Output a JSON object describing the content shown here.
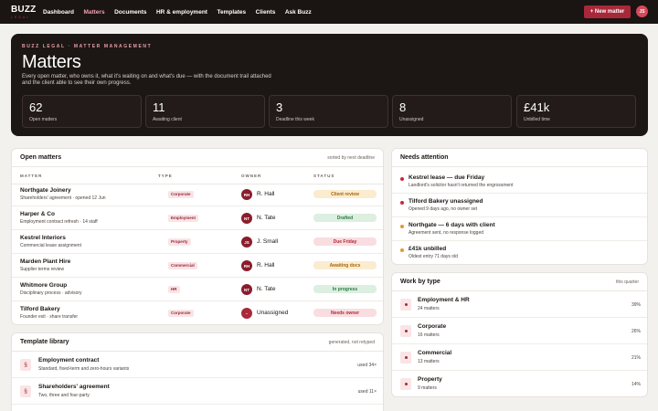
{
  "nav": {
    "logo": "BUZZ",
    "logo_sub": "LEGAL",
    "links": [
      "Dashboard",
      "Matters",
      "Documents",
      "HR & employment",
      "Templates",
      "Clients",
      "Ask Buzz"
    ],
    "active": "Matters",
    "new_button": "+ New matter",
    "avatar": "JS"
  },
  "hero": {
    "eyebrow": "BUZZ LEGAL · MATTER MANAGEMENT",
    "title": "Matters",
    "description": "Every open matter, who owns it, what it's waiting on and what's due — with the document trail attached and the client able to see their own progress.",
    "stats": [
      {
        "value": "62",
        "label": "Open matters"
      },
      {
        "value": "11",
        "label": "Awaiting client"
      },
      {
        "value": "3",
        "label": "Deadline this week"
      },
      {
        "value": "8",
        "label": "Unassigned"
      },
      {
        "value": "£41k",
        "label": "Unbilled time"
      }
    ]
  },
  "open_matters": {
    "title": "Open matters",
    "meta": "sorted by next deadline",
    "columns": [
      "MATTER",
      "TYPE",
      "OWNER",
      "STATUS"
    ],
    "rows": [
      {
        "name": "Northgate Joinery",
        "sub": "Shareholders' agreement · opened 12 Jun",
        "type": "Corporate",
        "owner_initials": "RH",
        "owner": "R. Hall",
        "status": "Client review"
      },
      {
        "name": "Harper & Co",
        "sub": "Employment contract refresh · 14 staff",
        "type": "Employment",
        "owner_initials": "NT",
        "owner": "N. Tate",
        "status": "Drafted"
      },
      {
        "name": "Kestrel Interiors",
        "sub": "Commercial lease assignment",
        "type": "Property",
        "owner_initials": "JS",
        "owner": "J. Small",
        "status": "Due Friday"
      },
      {
        "name": "Marden Plant Hire",
        "sub": "Supplier terms review",
        "type": "Commercial",
        "owner_initials": "RH",
        "owner": "R. Hall",
        "status": "Awaiting docs"
      },
      {
        "name": "Whitmore Group",
        "sub": "Disciplinary process · advisory",
        "type": "HR",
        "owner_initials": "NT",
        "owner": "N. Tate",
        "status": "In progress"
      },
      {
        "name": "Tilford Bakery",
        "sub": "Founder exit · share transfer",
        "type": "Corporate",
        "owner_initials": "–",
        "owner": "Unassigned",
        "status": "Needs owner"
      }
    ]
  },
  "template_library": {
    "title": "Template library",
    "meta": "generated, not retyped",
    "items": [
      {
        "icon": "§",
        "name": "Employment contract",
        "sub": "Standard, fixed-term and zero-hours variants",
        "used": "used 34×"
      },
      {
        "icon": "§",
        "name": "Shareholders' agreement",
        "sub": "Two, three and four-party",
        "used": "used 11×"
      }
    ]
  },
  "needs_attention": {
    "title": "Needs attention",
    "items": [
      {
        "title": "Kestrel lease — due Friday",
        "sub": "Landlord's solicitor hasn't returned the engrossment",
        "level": "red"
      },
      {
        "title": "Tilford Bakery unassigned",
        "sub": "Opened 9 days ago, no owner set",
        "level": "red"
      },
      {
        "title": "Northgate — 6 days with client",
        "sub": "Agreement sent, no response logged",
        "level": "amber"
      },
      {
        "title": "£41k unbilled",
        "sub": "Oldest entry 71 days old",
        "level": "amber"
      }
    ]
  },
  "work_by_type": {
    "title": "Work by type",
    "meta": "this quarter",
    "items": [
      {
        "name": "Employment & HR",
        "count": "24 matters",
        "pct": "39%"
      },
      {
        "name": "Corporate",
        "count": "16 matters",
        "pct": "26%"
      },
      {
        "name": "Commercial",
        "count": "13 matters",
        "pct": "21%"
      },
      {
        "name": "Property",
        "count": "9 matters",
        "pct": "14%"
      }
    ]
  },
  "colors": {
    "brand": "#a8283a",
    "nav_bg": "#1a1412",
    "hero_bg": "#1c1614",
    "page_bg": "#f3f1ee"
  }
}
